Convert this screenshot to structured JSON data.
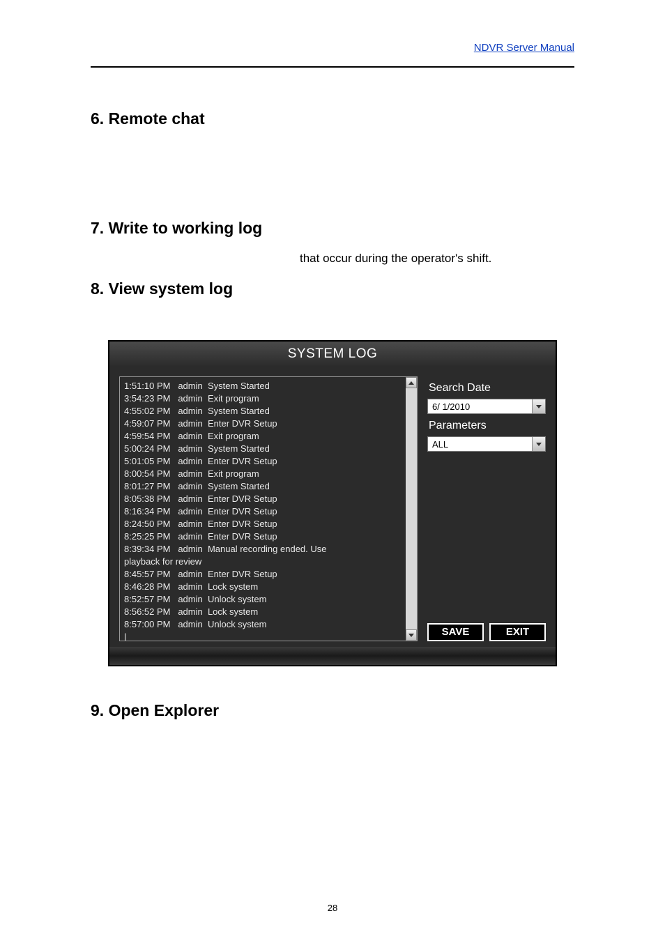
{
  "header": {
    "link_text": "NDVR Server Manual"
  },
  "sections": {
    "s6": "6. Remote chat",
    "s7": "7. Write to working log",
    "s7_body": "that occur during the operator's shift.",
    "s8": "8. View system log",
    "s9": "9. Open Explorer"
  },
  "dialog": {
    "title": "SYSTEM LOG",
    "log_text": "1:51:10 PM   admin  System Started\n3:54:23 PM   admin  Exit program\n4:55:02 PM   admin  System Started\n4:59:07 PM   admin  Enter DVR Setup\n4:59:54 PM   admin  Exit program\n5:00:24 PM   admin  System Started\n5:01:05 PM   admin  Enter DVR Setup\n8:00:54 PM   admin  Exit program\n8:01:27 PM   admin  System Started\n8:05:38 PM   admin  Enter DVR Setup\n8:16:34 PM   admin  Enter DVR Setup\n8:24:50 PM   admin  Enter DVR Setup\n8:25:25 PM   admin  Enter DVR Setup\n8:39:34 PM   admin  Manual recording ended. Use\nplayback for review\n8:45:57 PM   admin  Enter DVR Setup\n8:46:28 PM   admin  Lock system\n8:52:57 PM   admin  Unlock system\n8:56:52 PM   admin  Lock system\n8:57:00 PM   admin  Unlock system\n|",
    "search_date_label": "Search Date",
    "search_date_value": " 6/ 1/2010",
    "parameters_label": "Parameters",
    "parameters_value": "ALL",
    "save_label": "SAVE",
    "exit_label": "EXIT"
  },
  "page_number": "28"
}
